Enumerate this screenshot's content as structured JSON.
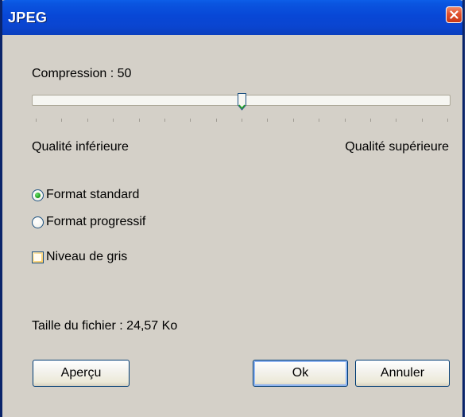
{
  "window": {
    "title": "JPEG"
  },
  "compression": {
    "label": "Compression : 50",
    "value": 50,
    "min": 0,
    "max": 100,
    "tick_count": 17,
    "low_label": "Qualité inférieure",
    "high_label": "Qualité supérieure"
  },
  "format": {
    "options": [
      {
        "label": "Format standard",
        "selected": true
      },
      {
        "label": "Format progressif",
        "selected": false
      }
    ]
  },
  "grayscale": {
    "label": "Niveau de gris",
    "checked": false
  },
  "file_size": {
    "label": "Taille du fichier : 24,57 Ko"
  },
  "buttons": {
    "preview": "Aperçu",
    "ok": "Ok",
    "cancel": "Annuler"
  },
  "icons": {
    "close": "close-icon",
    "thumb": "slider-thumb-icon"
  },
  "colors": {
    "title_bar": "#0a4fd8",
    "dialog_bg": "#d4d0c8",
    "close_button": "#e0502c",
    "radio_dot": "#21a121",
    "checkbox_fill": "#f8c860"
  }
}
